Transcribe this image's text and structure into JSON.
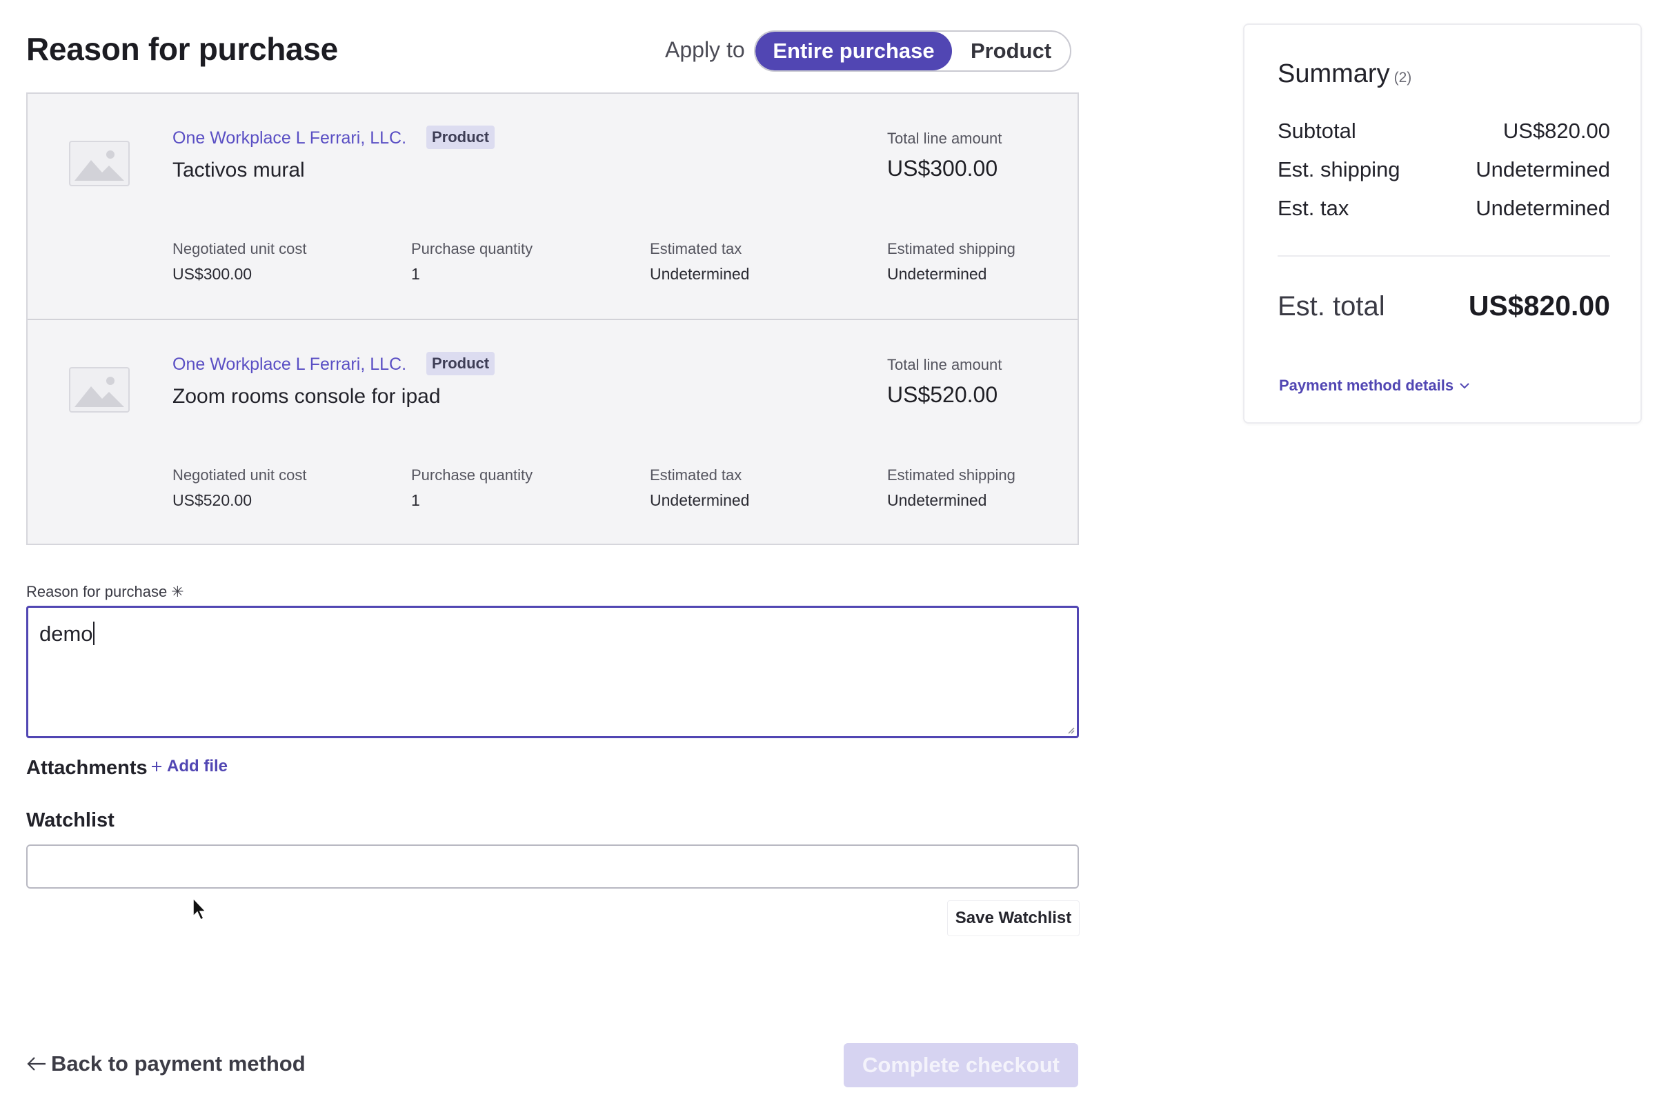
{
  "page": {
    "title": "Reason for purchase",
    "apply_to_label": "Apply to",
    "apply_options": [
      "Entire purchase",
      "Product"
    ],
    "apply_selected": "Entire purchase"
  },
  "items": [
    {
      "supplier": "One Workplace L Ferrari, LLC.",
      "badge": "Product",
      "name": "Tactivos mural",
      "total_line_amount_label": "Total line amount",
      "total_line_amount": "US$300.00",
      "negotiated_unit_cost_label": "Negotiated unit cost",
      "negotiated_unit_cost": "US$300.00",
      "purchase_quantity_label": "Purchase quantity",
      "purchase_quantity": "1",
      "estimated_tax_label": "Estimated tax",
      "estimated_tax": "Undetermined",
      "estimated_shipping_label": "Estimated shipping",
      "estimated_shipping": "Undetermined"
    },
    {
      "supplier": "One Workplace L Ferrari, LLC.",
      "badge": "Product",
      "name": "Zoom rooms console for ipad",
      "total_line_amount_label": "Total line amount",
      "total_line_amount": "US$520.00",
      "negotiated_unit_cost_label": "Negotiated unit cost",
      "negotiated_unit_cost": "US$520.00",
      "purchase_quantity_label": "Purchase quantity",
      "purchase_quantity": "1",
      "estimated_tax_label": "Estimated tax",
      "estimated_tax": "Undetermined",
      "estimated_shipping_label": "Estimated shipping",
      "estimated_shipping": "Undetermined"
    }
  ],
  "reason": {
    "label": "Reason for purchase",
    "required_mark": "✳",
    "value": "demo"
  },
  "attachments": {
    "label": "Attachments",
    "add_file": "Add file"
  },
  "watchlist": {
    "label": "Watchlist",
    "value": "",
    "save_label": "Save Watchlist"
  },
  "footer": {
    "back_label": "Back to payment method",
    "complete_label": "Complete checkout"
  },
  "summary": {
    "title": "Summary",
    "count": "(2)",
    "subtotal_label": "Subtotal",
    "subtotal": "US$820.00",
    "shipping_label": "Est. shipping",
    "shipping": "Undetermined",
    "tax_label": "Est. tax",
    "tax": "Undetermined",
    "total_label": "Est. total",
    "total": "US$820.00",
    "payment_details": "Payment method details"
  },
  "colors": {
    "accent": "#5146b3",
    "link": "#5a4fc4",
    "disabled_button": "#d6d3f1",
    "panel_bg": "#f4f4f6"
  },
  "icons": [
    "image-placeholder-icon",
    "plus-icon",
    "arrow-left-icon",
    "chevron-down-icon",
    "mouse-cursor-icon"
  ]
}
